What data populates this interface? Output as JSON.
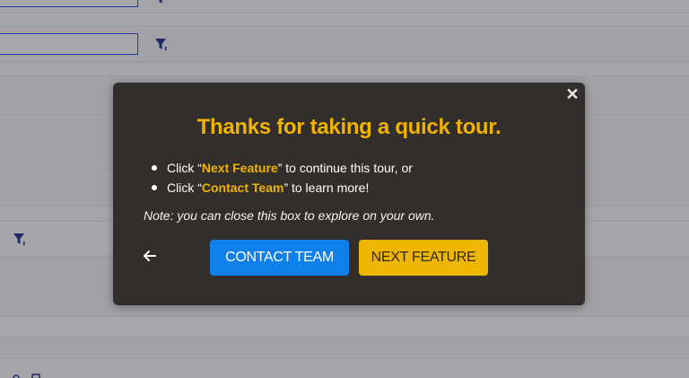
{
  "modal": {
    "title": "Thanks for taking a quick tour.",
    "close_symbol": "✕",
    "bullets": [
      {
        "prefix": "Click “",
        "highlight": "Next Feature",
        "suffix": "” to continue this tour, or"
      },
      {
        "prefix": "Click “",
        "highlight": "Contact Team",
        "suffix": "” to learn more!"
      }
    ],
    "note": "Note: you can close this box to explore on your own.",
    "back_icon": "arrow-left-icon",
    "contact_button_label": "CONTACT TEAM",
    "next_button_label": "NEXT FEATURE"
  },
  "background": {
    "filter_icon": "filter-icon"
  },
  "colors": {
    "modal_background": "#322e2c",
    "accent_yellow": "#f0b400",
    "contact_blue": "#0f80ea",
    "next_yellow": "#eeb502",
    "page_dim": "#a2a2a6",
    "input_border": "#2438a8"
  }
}
